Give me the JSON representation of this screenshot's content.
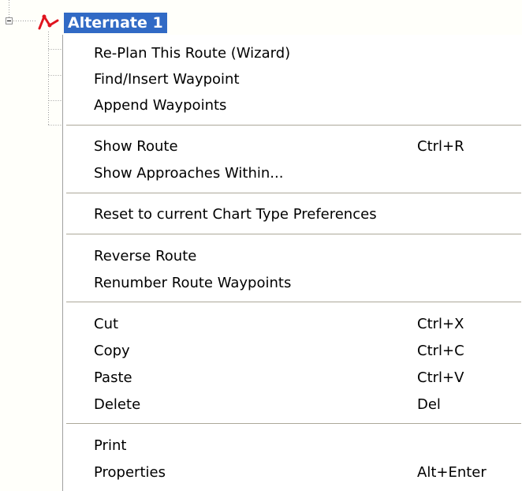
{
  "tree": {
    "node_label": "Alternate 1",
    "node_icon": "route-icon",
    "expander_icon": "collapse-minus-icon"
  },
  "menu": {
    "items": [
      {
        "label": "Re-Plan This Route (Wizard)",
        "shortcut": ""
      },
      {
        "label": "Find/Insert Waypoint",
        "shortcut": ""
      },
      {
        "label": "Append Waypoints",
        "shortcut": ""
      },
      {
        "label": "Show Route",
        "shortcut": "Ctrl+R"
      },
      {
        "label": "Show Approaches Within...",
        "shortcut": ""
      },
      {
        "label": "Reset to current Chart Type Preferences",
        "shortcut": ""
      },
      {
        "label": "Reverse Route",
        "shortcut": ""
      },
      {
        "label": "Renumber Route Waypoints",
        "shortcut": ""
      },
      {
        "label": "Cut",
        "shortcut": "Ctrl+X"
      },
      {
        "label": "Copy",
        "shortcut": "Ctrl+C"
      },
      {
        "label": "Paste",
        "shortcut": "Ctrl+V"
      },
      {
        "label": "Delete",
        "shortcut": "Del"
      },
      {
        "label": "Print",
        "shortcut": ""
      },
      {
        "label": "Properties",
        "shortcut": "Alt+Enter"
      }
    ]
  },
  "colors": {
    "selection": "#316ac5",
    "route_icon": "#e0141e",
    "separator": "#aca899"
  }
}
